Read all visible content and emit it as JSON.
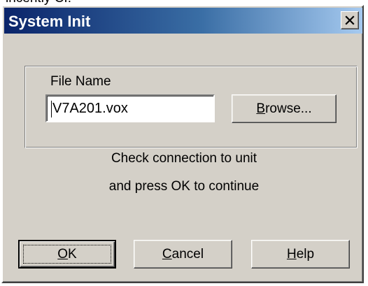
{
  "top_fragment": "incently CI:",
  "window": {
    "title": "System Init",
    "close_glyph": "close-icon"
  },
  "file_group": {
    "label": "File Name",
    "field_value": "V7A201.vox",
    "browse": {
      "mnemonic": "B",
      "rest": "rowse..."
    }
  },
  "message": {
    "line1": "Check connection to unit",
    "line2": "and press OK to continue"
  },
  "buttons": {
    "ok": {
      "mnemonic": "O",
      "rest": "K"
    },
    "cancel": {
      "mnemonic": "C",
      "rest": "ancel"
    },
    "help": {
      "mnemonic": "H",
      "rest": "elp"
    }
  },
  "colors": {
    "face": "#d4d0c8",
    "title_start": "#0a246a",
    "title_end": "#a6caf0",
    "title_text": "#ffffff"
  }
}
